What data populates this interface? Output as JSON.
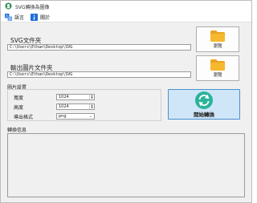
{
  "window": {
    "title": "SVG轉換為圖像"
  },
  "menu": [
    {
      "label": "語言",
      "icon": "language-icon"
    },
    {
      "label": "關於",
      "icon": "info-icon"
    }
  ],
  "svg_folder": {
    "label": "SVG文件夾",
    "path": "C:\\Users\\Ethan\\Desktop\\SVG",
    "browse_label": "瀏覽"
  },
  "output_folder": {
    "label": "輸出圖片文件夾",
    "path": "C:\\Users\\Ethan\\Desktop\\SVG",
    "browse_label": "瀏覽"
  },
  "image_settings": {
    "title": "圖片設置",
    "width_label": "寬度",
    "width_value": "1024",
    "height_label": "高度",
    "height_value": "1024",
    "format_label": "導出格式",
    "format_value": "png"
  },
  "convert_button": {
    "label": "開始轉換"
  },
  "log": {
    "title": "轉換信息"
  },
  "colors": {
    "accent_border": "#4a90d0",
    "accent_fill": "#cfe6f8",
    "folder_yellow": "#f5b82e",
    "convert_green": "#2bb39a"
  }
}
